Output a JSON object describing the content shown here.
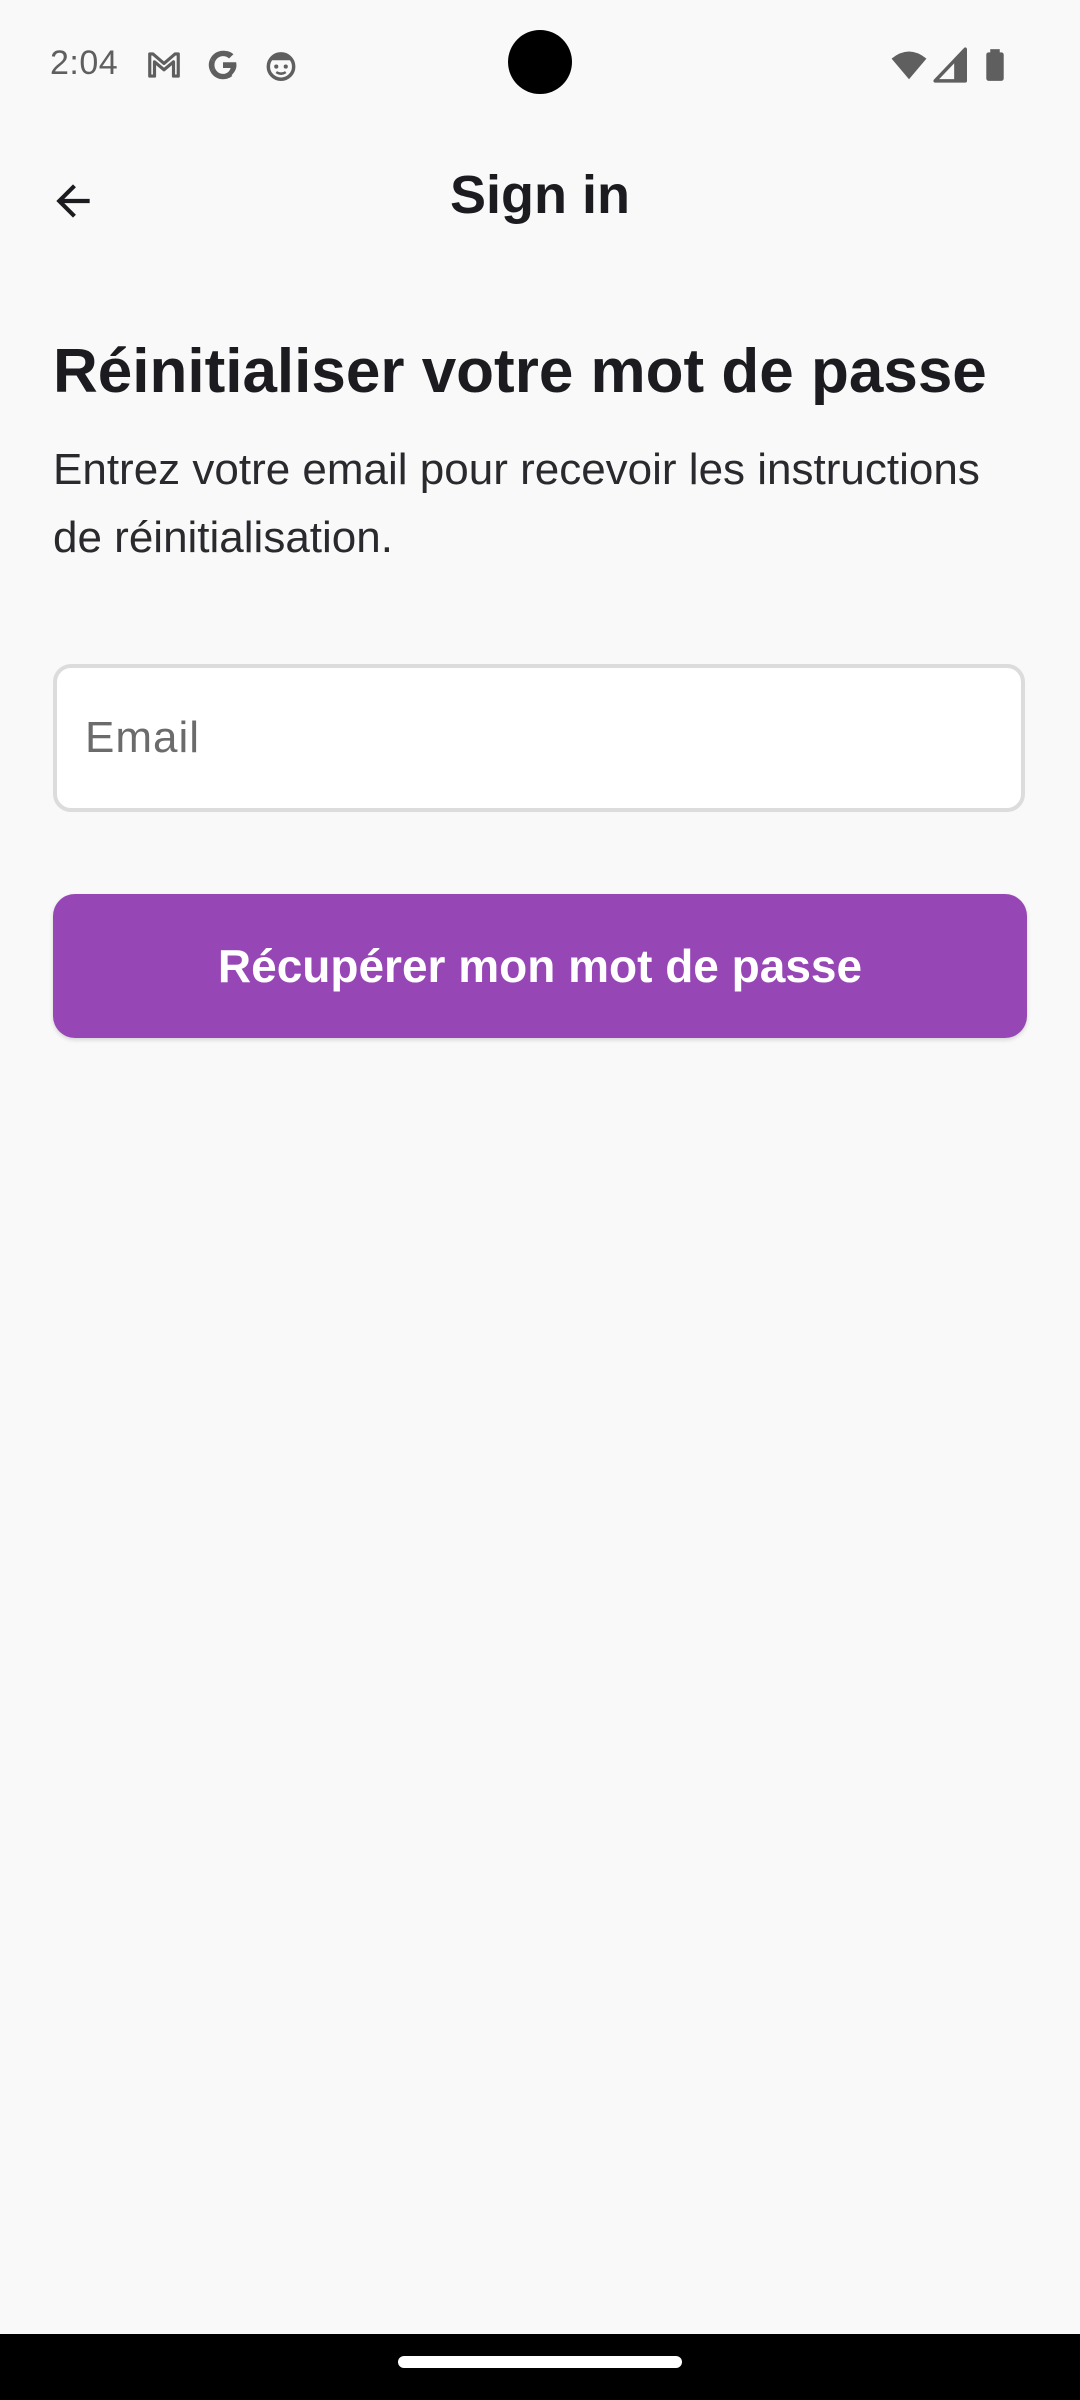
{
  "status_bar": {
    "time": "2:04",
    "left_icons": [
      "gmail-icon",
      "google-icon",
      "face-icon"
    ],
    "right_icons": [
      "wifi-icon",
      "cellular-signal-icon",
      "battery-icon"
    ]
  },
  "app_bar": {
    "title": "Sign in",
    "back_icon": "arrow-back-icon"
  },
  "content": {
    "heading": "Réinitialiser votre mot de passe",
    "description": "Entrez votre email pour recevoir les instructions de réinitialisation."
  },
  "form": {
    "email_placeholder": "Email",
    "email_value": "",
    "submit_label": "Récupérer mon mot de passe"
  },
  "colors": {
    "accent": "#9747b5",
    "background": "#f9f9f9",
    "text": "#1c1b1f"
  }
}
